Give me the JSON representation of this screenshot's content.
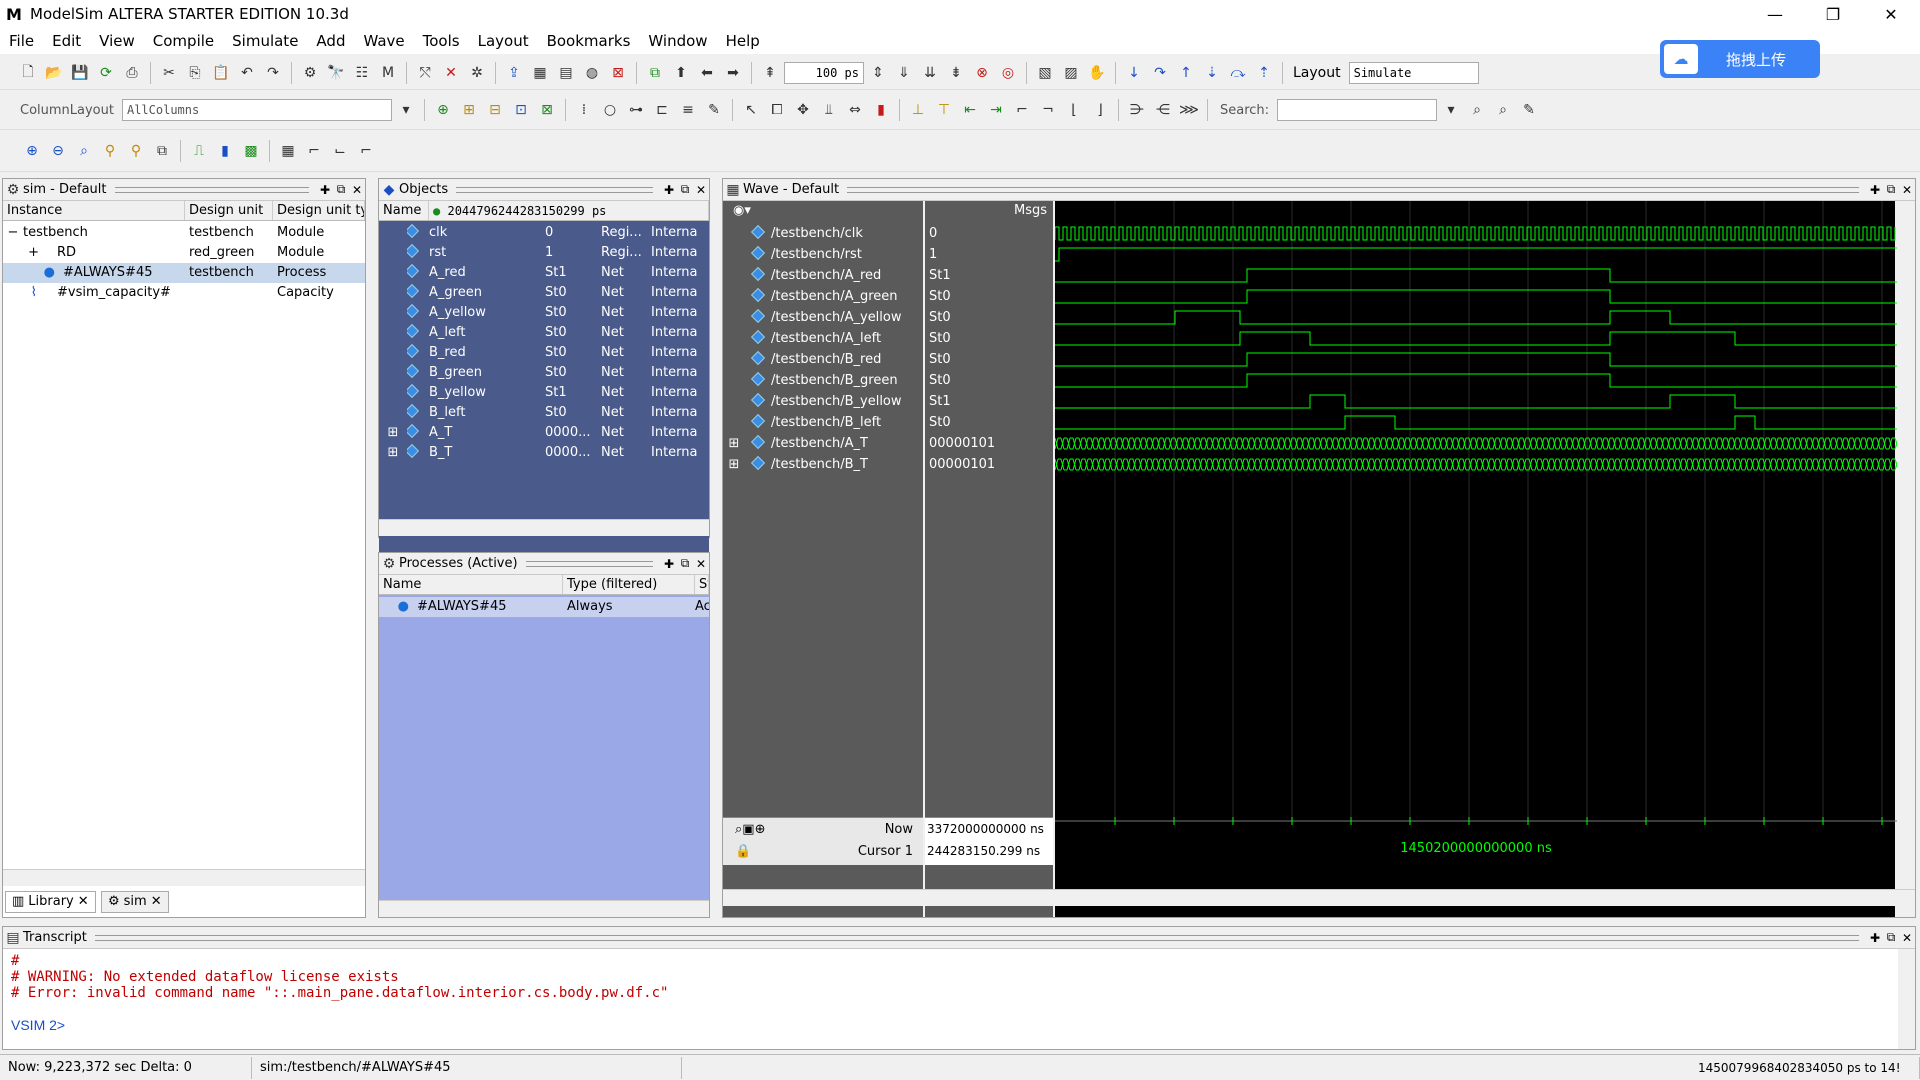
{
  "window": {
    "title": "ModelSim ALTERA STARTER EDITION 10.3d",
    "logo": "M",
    "minimize": "—",
    "restore": "❐",
    "close": "✕"
  },
  "menu": [
    "File",
    "Edit",
    "View",
    "Compile",
    "Simulate",
    "Add",
    "Wave",
    "Tools",
    "Layout",
    "Bookmarks",
    "Window",
    "Help"
  ],
  "toolbar": {
    "runlength": "100 ps",
    "layout_label": "Layout",
    "layout_value": "Simulate",
    "columnlayout_label": "ColumnLayout",
    "columnlayout_value": "AllColumns",
    "search_label": "Search:",
    "search_value": ""
  },
  "upload": {
    "label": "拖拽上传"
  },
  "sim_pane": {
    "title": "sim - Default",
    "columns": [
      "Instance",
      "Design unit",
      "Design unit typ"
    ],
    "rows": [
      {
        "expander": "−",
        "name": "testbench",
        "unit": "testbench",
        "type": "Module"
      },
      {
        "expander": "+",
        "name": "RD",
        "unit": "red_green",
        "type": "Module"
      },
      {
        "expander": "",
        "name": "#ALWAYS#45",
        "unit": "testbench",
        "type": "Process"
      },
      {
        "expander": "",
        "name": "#vsim_capacity#",
        "unit": "",
        "type": "Capacity"
      }
    ],
    "tabs": [
      "Library",
      "sim"
    ]
  },
  "objects_pane": {
    "title": "Objects",
    "col_name": "Name",
    "time": "20447962442831502​99 ps",
    "rows": [
      {
        "name": "clk",
        "value": "0",
        "kind": "Regi...",
        "mode": "Interna"
      },
      {
        "name": "rst",
        "value": "1",
        "kind": "Regi...",
        "mode": "Interna"
      },
      {
        "name": "A_red",
        "value": "St1",
        "kind": "Net",
        "mode": "Interna"
      },
      {
        "name": "A_green",
        "value": "St0",
        "kind": "Net",
        "mode": "Interna"
      },
      {
        "name": "A_yellow",
        "value": "St0",
        "kind": "Net",
        "mode": "Interna"
      },
      {
        "name": "A_left",
        "value": "St0",
        "kind": "Net",
        "mode": "Interna"
      },
      {
        "name": "B_red",
        "value": "St0",
        "kind": "Net",
        "mode": "Interna"
      },
      {
        "name": "B_green",
        "value": "St0",
        "kind": "Net",
        "mode": "Interna"
      },
      {
        "name": "B_yellow",
        "value": "St1",
        "kind": "Net",
        "mode": "Interna"
      },
      {
        "name": "B_left",
        "value": "St0",
        "kind": "Net",
        "mode": "Interna"
      },
      {
        "name": "A_T",
        "value": "0000...",
        "kind": "Net",
        "mode": "Interna"
      },
      {
        "name": "B_T",
        "value": "0000...",
        "kind": "Net",
        "mode": "Interna"
      }
    ]
  },
  "processes_pane": {
    "title": "Processes (Active)",
    "columns": [
      "Name",
      "Type (filtered)",
      "St"
    ],
    "rows": [
      {
        "name": "#ALWAYS#45",
        "type": "Always",
        "state": "Ac"
      }
    ]
  },
  "wave_pane": {
    "title": "Wave - Default",
    "msgs_label": "Msgs",
    "signals": [
      {
        "name": "/testbench/clk",
        "value": "0"
      },
      {
        "name": "/testbench/rst",
        "value": "1"
      },
      {
        "name": "/testbench/A_red",
        "value": "St1"
      },
      {
        "name": "/testbench/A_green",
        "value": "St0"
      },
      {
        "name": "/testbench/A_yellow",
        "value": "St0"
      },
      {
        "name": "/testbench/A_left",
        "value": "St0"
      },
      {
        "name": "/testbench/B_red",
        "value": "St0"
      },
      {
        "name": "/testbench/B_green",
        "value": "St0"
      },
      {
        "name": "/testbench/B_yellow",
        "value": "St1"
      },
      {
        "name": "/testbench/B_left",
        "value": "St0"
      },
      {
        "name": "/testbench/A_T",
        "value": "00000101"
      },
      {
        "name": "/testbench/B_T",
        "value": "00000101"
      }
    ],
    "now_label": "Now",
    "now_value": "3372000000000 ns",
    "cursor_label": "Cursor 1",
    "cursor_value": "244283150.299 ns",
    "timeline_label": "1450200000000000 ns"
  },
  "transcript": {
    "title": "Transcript",
    "lines": [
      {
        "text": "#",
        "color": "#c00000"
      },
      {
        "text": "# WARNING: No extended dataflow license exists",
        "color": "#c00000"
      },
      {
        "text": "# Error: invalid command name \"::.main_pane.dataflow.interior.cs.body.pw.df.c\"",
        "color": "#c00000"
      }
    ],
    "prompt": "VSIM 2>"
  },
  "status": {
    "now": "Now: 9,223,372 sec  Delta: 0",
    "context": "sim:/testbench/#ALWAYS#45",
    "range": "1450079968402834050 ps to 14!"
  },
  "colors": {
    "wave_green": "#00ff00",
    "objects_bg": "#4a5a8a",
    "processes_bg": "#9aa8e8",
    "panel_gray": "#5a5a5a",
    "error_red": "#c00000"
  }
}
